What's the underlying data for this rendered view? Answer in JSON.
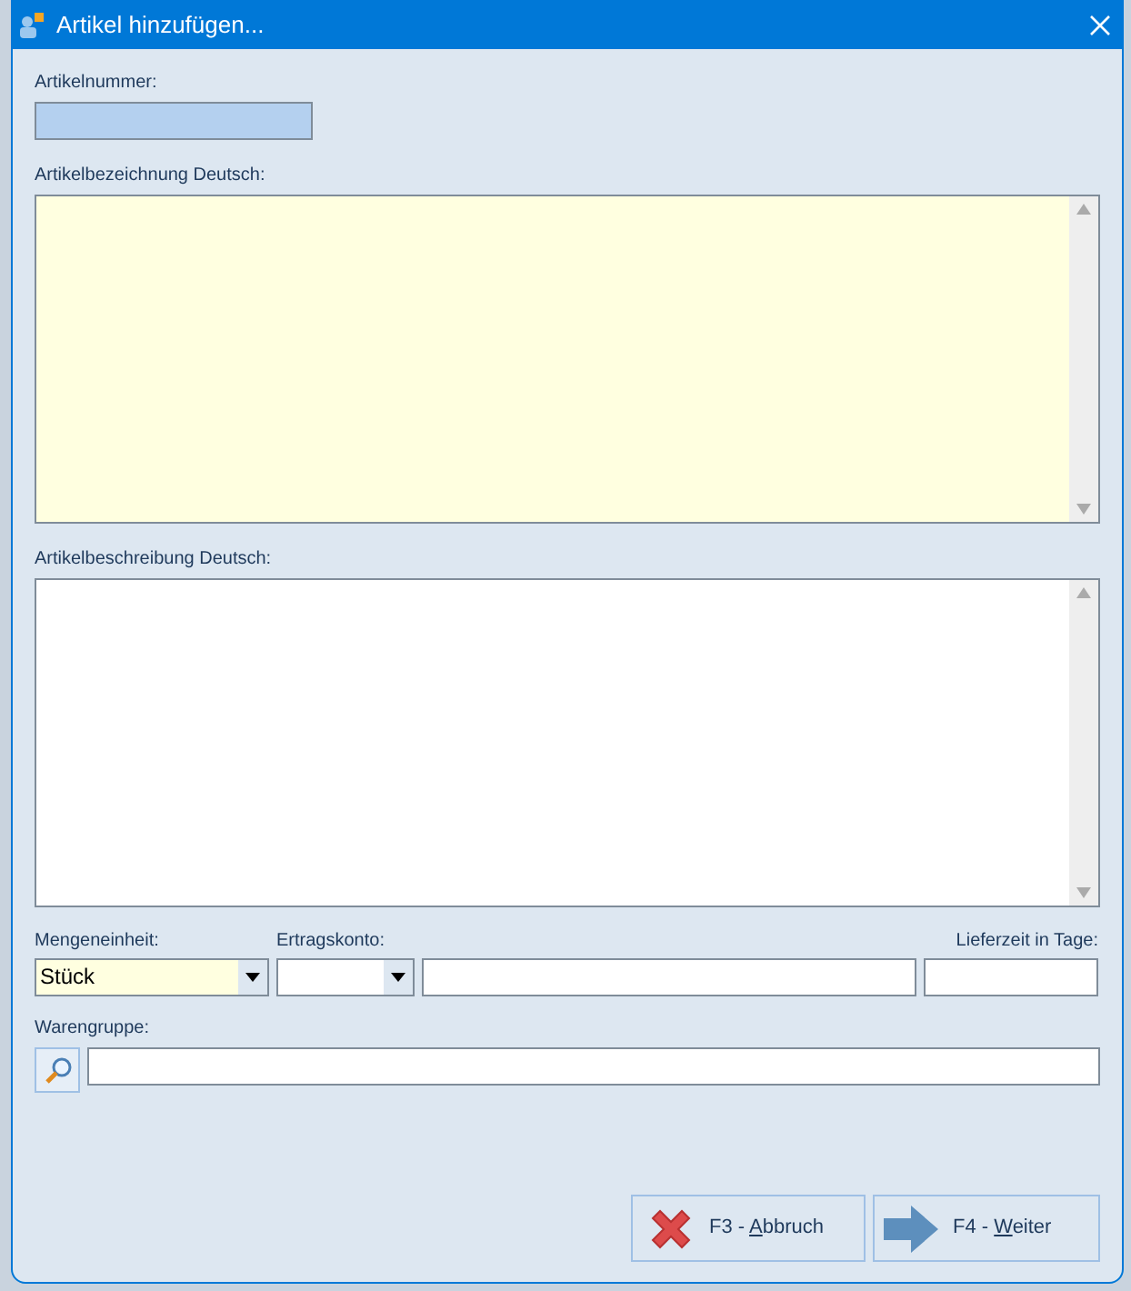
{
  "window": {
    "title": "Artikel hinzufügen..."
  },
  "fields": [
    {
      "kind": "text",
      "label": "Artikelnummer:",
      "readonly": true
    },
    {
      "kind": "memo",
      "label": "Artikelbezeichnung Deutsch:",
      "required": true
    },
    {
      "kind": "memo",
      "label": "Artikelbeschreibung Deutsch:",
      "required": false
    }
  ],
  "row": [
    {
      "kind": "combo",
      "label": "Mengeneinheit:",
      "value": "Stück",
      "required": true
    },
    {
      "kind": "combo",
      "label": "Ertragskonto:",
      "required": false
    },
    {
      "kind": "text"
    },
    {
      "kind": "text",
      "label": "Lieferzeit in Tage:"
    }
  ],
  "warengruppe": {
    "label": "Warengruppe:"
  },
  "buttons": [
    {
      "kind": "cancel",
      "label_parts": [
        "F3 - ",
        "A",
        "bbruch"
      ]
    },
    {
      "kind": "next",
      "label_parts": [
        "F4 - ",
        "W",
        "eiter"
      ]
    }
  ]
}
